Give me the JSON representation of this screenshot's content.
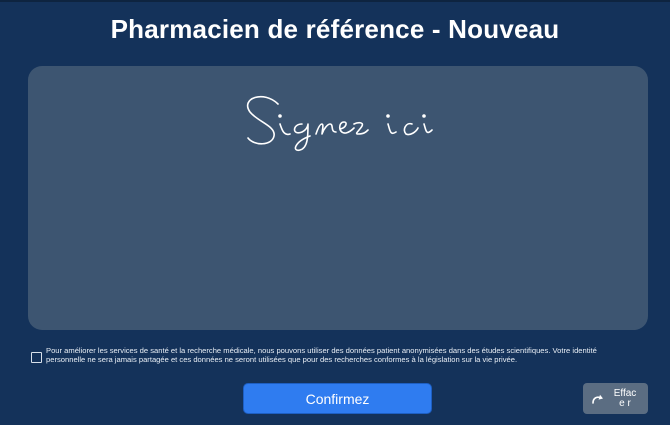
{
  "header": {
    "title": "Pharmacien de référence - Nouveau"
  },
  "signature_pad": {
    "placeholder": "Signez ici"
  },
  "consent": {
    "checked": false,
    "text": "Pour améliorer les services de santé et la recherche médicale, nous pouvons utiliser des données patient anonymisées dans des études scientifiques. Votre identité personnelle ne sera jamais partagée et ces données ne seront utilisées que pour des recherches conformes à la législation sur la vie privée."
  },
  "actions": {
    "confirm_label": "Confirmez",
    "clear_label": "Efface r",
    "clear_icon": "redo-icon"
  },
  "colors": {
    "background": "#14325a",
    "pad": "#3d5571",
    "confirm": "#2f7cf0",
    "clear": "#5b6d82"
  }
}
